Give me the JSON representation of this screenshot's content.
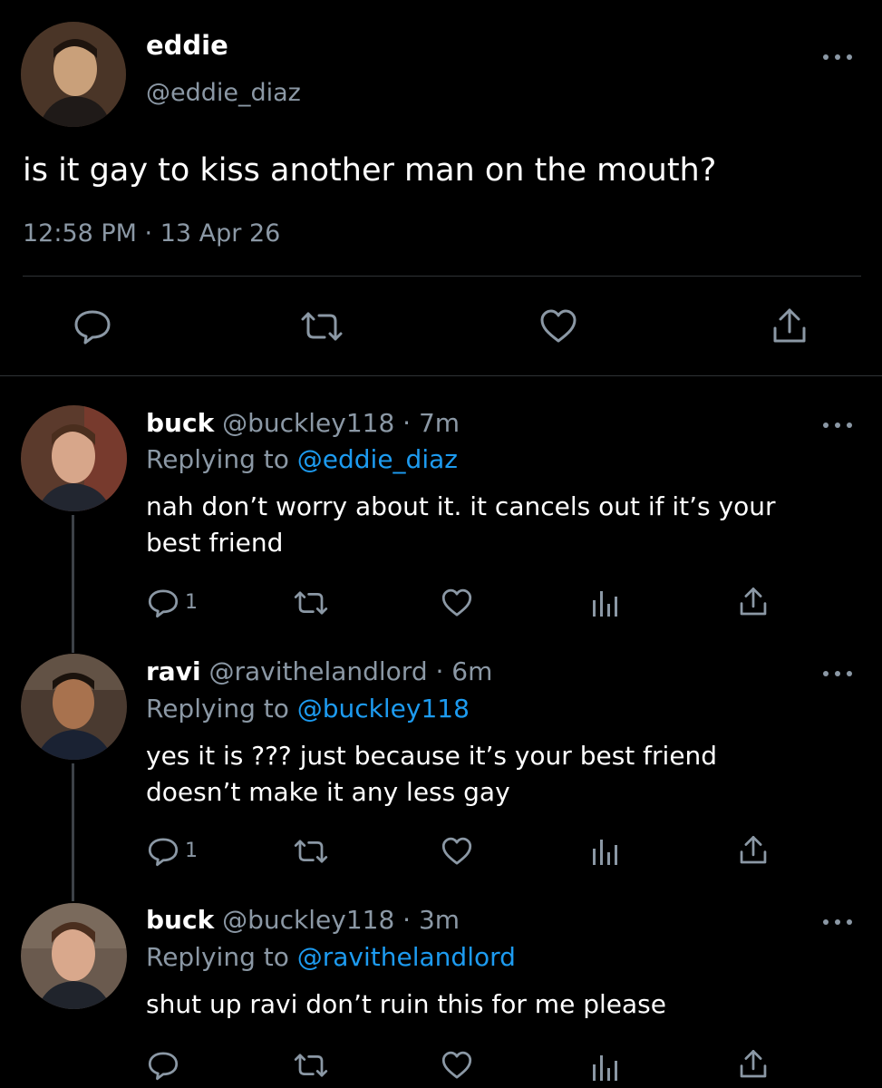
{
  "main_tweet": {
    "name": "eddie",
    "handle": "@eddie_diaz",
    "text": "is it gay to kiss another man on the mouth?",
    "meta": "12:58 PM · 13 Apr 26"
  },
  "replies": [
    {
      "name": "buck",
      "handle_time": "@buckley118 · 7m",
      "replying_prefix": "Replying to",
      "replying_to": "@eddie_diaz",
      "line1": "nah don’t worry about it. it cancels out if it’s your",
      "line2": "best friend",
      "reply_count": "1"
    },
    {
      "name": "ravi",
      "handle_time": "@ravithelandlord · 6m",
      "replying_prefix": "Replying to",
      "replying_to": "@buckley118",
      "line1": "yes it is ??? just because it’s your best friend",
      "line2": "doesn’t make it any less gay",
      "reply_count": "1"
    },
    {
      "name": "buck",
      "handle_time": "@buckley118 · 3m",
      "replying_prefix": "Replying to",
      "replying_to": "@ravithelandlord",
      "line1": "shut up ravi don’t ruin this for me please",
      "line2": "",
      "reply_count": ""
    }
  ],
  "colors": {
    "background": "#000000",
    "secondary_text": "#8b98a5",
    "link": "#1d9bf0",
    "divider": "#2f3336"
  },
  "icons": [
    "reply-icon",
    "retweet-icon",
    "like-icon",
    "analytics-icon",
    "share-icon",
    "more-icon"
  ]
}
